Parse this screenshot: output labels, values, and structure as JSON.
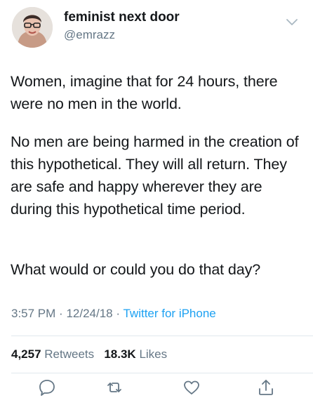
{
  "user": {
    "display_name": "feminist next door",
    "handle": "@emrazz"
  },
  "tweet": {
    "paragraphs": [
      "Women, imagine that for 24 hours, there were no men in the world.",
      "No men are being harmed in the creation of this hypothetical. They will all return. They are safe and happy wherever they are during this hypothetical time period.",
      "What would or could you do that day?"
    ],
    "time": "3:57 PM",
    "date": "12/24/18",
    "separator": "·",
    "source": "Twitter for iPhone"
  },
  "stats": {
    "retweets_count": "4,257",
    "retweets_label": "Retweets",
    "likes_count": "18.3K",
    "likes_label": "Likes"
  },
  "icons": [
    "chevron-down-icon",
    "reply-icon",
    "retweet-icon",
    "like-icon",
    "share-icon"
  ],
  "colors": {
    "text": "#14171a",
    "secondary": "#657786",
    "link": "#1da1f2",
    "divider": "#e1e8ed"
  }
}
